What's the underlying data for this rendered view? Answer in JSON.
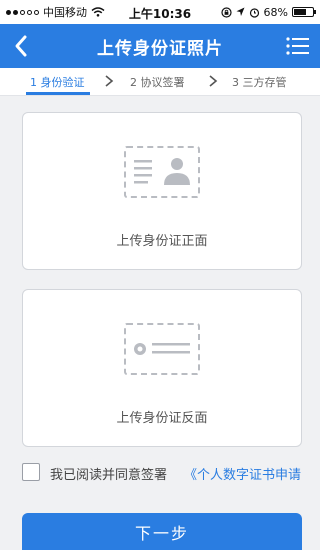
{
  "status_bar": {
    "carrier": "中国移动",
    "time": "上午10:36",
    "battery": "68%",
    "battery_level": 0.68,
    "icons": [
      "signal-dots-icon",
      "wifi-icon",
      "rotation-lock-icon",
      "location-arrow-icon",
      "alarm-icon",
      "battery-icon"
    ]
  },
  "nav": {
    "title": "上传身份证照片",
    "back_icon": "chevron-left-icon",
    "menu_icon": "list-menu-icon"
  },
  "steps": [
    {
      "label": "1 身份验证",
      "active": true
    },
    {
      "label": "2 协议签署",
      "active": false
    },
    {
      "label": "3 三方存管",
      "active": false
    }
  ],
  "cards": {
    "front_label": "上传身份证正面",
    "back_label": "上传身份证反面"
  },
  "agreement": {
    "text": "我已阅读并同意签署",
    "link": "《个人数字证书申请",
    "checked": false
  },
  "next_button": "下一步",
  "colors": {
    "primary": "#2a7de1",
    "background": "#f0f1f3",
    "card_border": "#d3d6db"
  }
}
